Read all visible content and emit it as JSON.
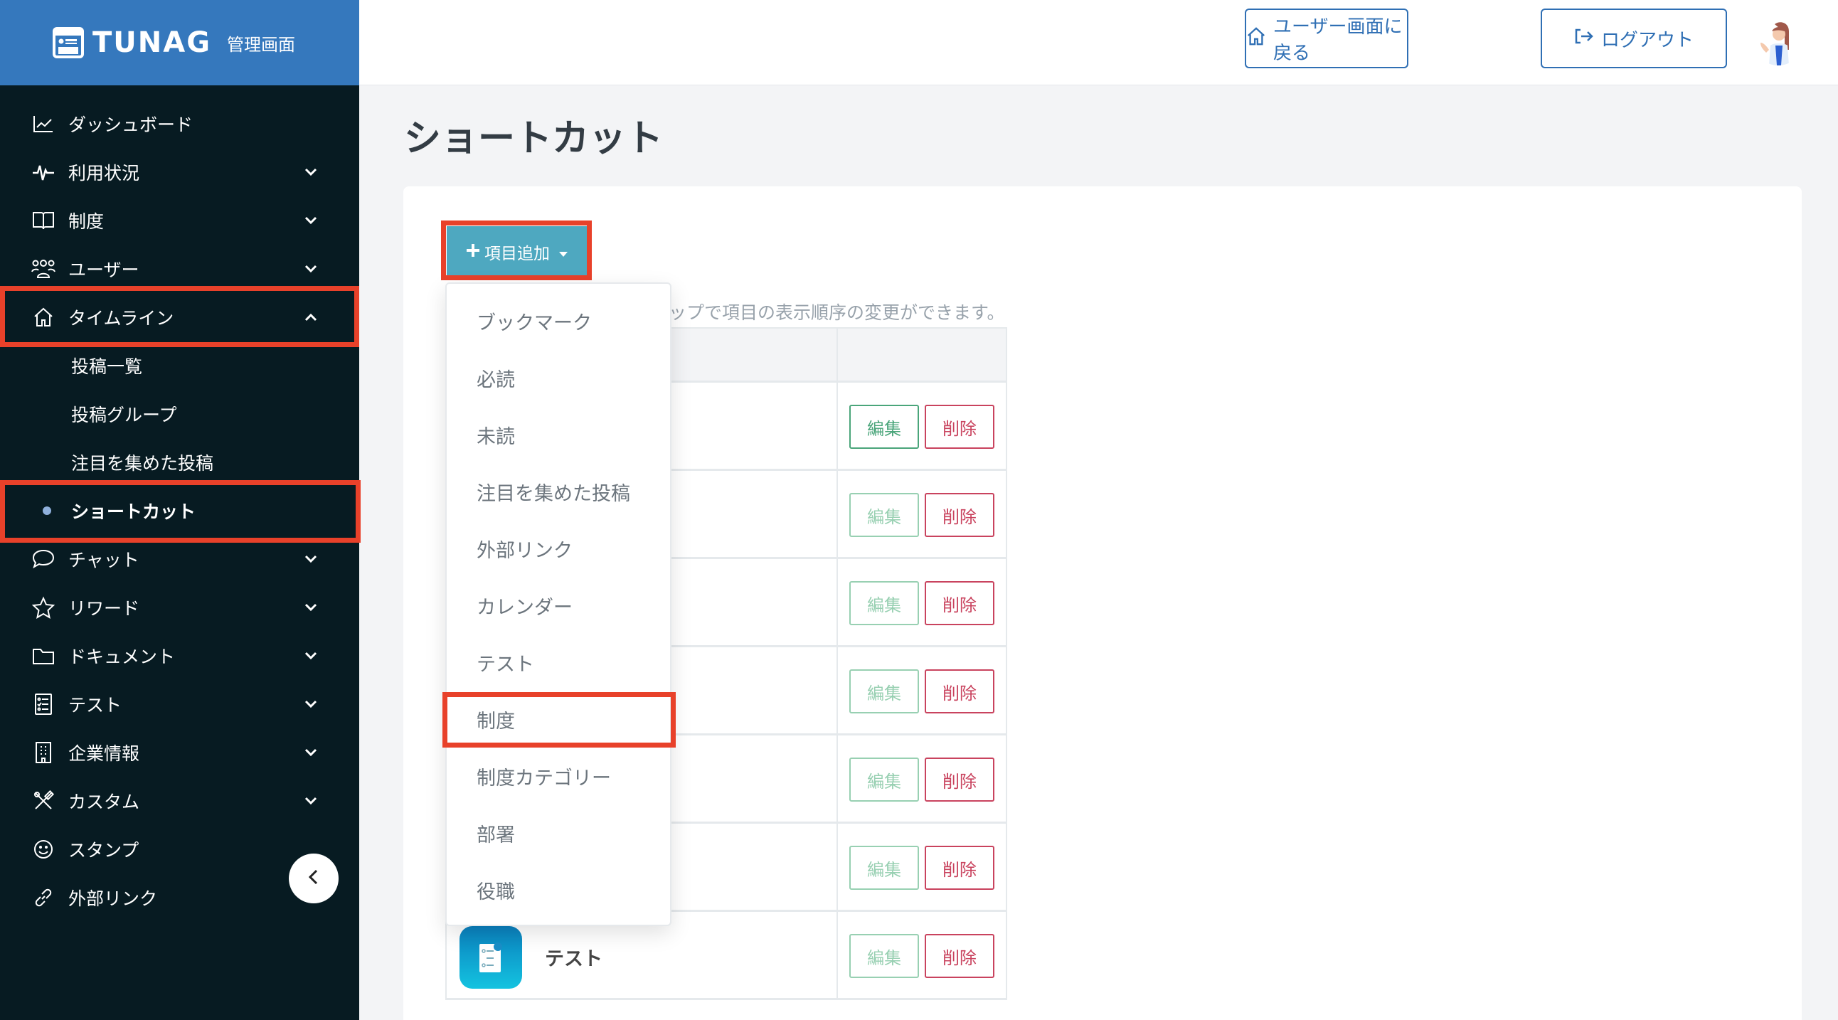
{
  "app": {
    "brand": "TUNAG",
    "brand_sub": "管理画面",
    "accent_color": "#3578bd"
  },
  "header": {
    "back_to_user_label": "ユーザー画面に戻る",
    "logout_label": "ログアウト"
  },
  "sidebar": {
    "items": [
      {
        "label": "ダッシュボード",
        "icon": "chart-line-icon",
        "has_chevron": false
      },
      {
        "label": "利用状況",
        "icon": "activity-icon",
        "has_chevron": true
      },
      {
        "label": "制度",
        "icon": "book-open-icon",
        "has_chevron": true
      },
      {
        "label": "ユーザー",
        "icon": "users-icon",
        "has_chevron": true
      },
      {
        "label": "タイムライン",
        "icon": "home-icon",
        "has_chevron": true,
        "expanded": true
      },
      {
        "label": "チャット",
        "icon": "chat-bubble-icon",
        "has_chevron": true
      },
      {
        "label": "リワード",
        "icon": "star-icon",
        "has_chevron": true
      },
      {
        "label": "ドキュメント",
        "icon": "folder-icon",
        "has_chevron": true
      },
      {
        "label": "テスト",
        "icon": "checklist-icon",
        "has_chevron": true
      },
      {
        "label": "企業情報",
        "icon": "building-icon",
        "has_chevron": true
      },
      {
        "label": "カスタム",
        "icon": "tools-icon",
        "has_chevron": true
      },
      {
        "label": "スタンプ",
        "icon": "smile-icon",
        "has_chevron": false
      },
      {
        "label": "外部リンク",
        "icon": "link-icon",
        "has_chevron": false
      }
    ],
    "timeline_sub": [
      {
        "label": "投稿一覧",
        "active": false
      },
      {
        "label": "投稿グループ",
        "active": false
      },
      {
        "label": "注目を集めた投稿",
        "active": false
      },
      {
        "label": "ショートカット",
        "active": true
      }
    ]
  },
  "main": {
    "page_title": "ショートカット",
    "add_button_label": "項目追加",
    "hint_text": "ップで項目の表示順序の変更ができます。",
    "edit_label": "編集",
    "delete_label": "削除",
    "rows": [
      {
        "name": "",
        "edit_active": true
      },
      {
        "name": "",
        "edit_active": false
      },
      {
        "name": "",
        "edit_active": false
      },
      {
        "name": "",
        "edit_active": false
      },
      {
        "name": "",
        "edit_active": false
      },
      {
        "name": "",
        "edit_active": false
      },
      {
        "name": "テスト",
        "edit_active": false
      }
    ]
  },
  "dropdown": {
    "items": [
      "ブックマーク",
      "必読",
      "未読",
      "注目を集めた投稿",
      "外部リンク",
      "カレンダー",
      "テスト",
      "制度",
      "制度カテゴリー",
      "部署",
      "役職"
    ],
    "highlighted": "制度"
  }
}
